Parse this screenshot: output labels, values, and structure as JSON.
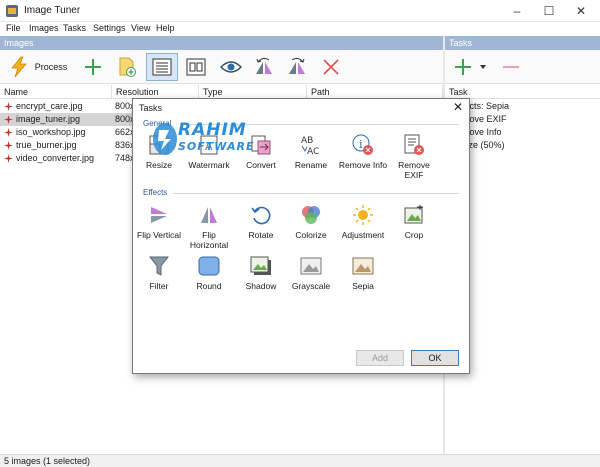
{
  "window": {
    "title": "Image Tuner",
    "controls": {
      "minimize": "–",
      "maximize": "☐",
      "close": "✕"
    }
  },
  "menu": [
    "File",
    "Images",
    "Tasks",
    "Settings",
    "View",
    "Help"
  ],
  "panels": {
    "images_header": "Images",
    "tasks_header": "Tasks"
  },
  "toolbar": {
    "process_label": "Process"
  },
  "columns": {
    "name": "Name",
    "resolution": "Resolution",
    "type": "Type",
    "path": "Path",
    "task": "Task"
  },
  "files": [
    {
      "name": "encrypt_care.jpg",
      "resolution": "800x",
      "selected": false
    },
    {
      "name": "image_tuner.jpg",
      "resolution": "800x",
      "selected": true
    },
    {
      "name": "iso_workshop.jpg",
      "resolution": "662x",
      "selected": false
    },
    {
      "name": "true_burner.jpg",
      "resolution": "836x",
      "selected": false
    },
    {
      "name": "video_converter.jpg",
      "resolution": "748x",
      "selected": false
    }
  ],
  "tasks_list": [
    "fects: Sepia",
    "move EXIF",
    "move Info",
    "size (50%)"
  ],
  "status": "5 images (1 selected)",
  "dialog": {
    "title": "Tasks",
    "close": "✕",
    "general_label": "General",
    "effects_label": "Effects",
    "general_items": [
      "Resize",
      "Watermark",
      "Convert",
      "Rename",
      "Remove Info",
      "Remove EXIF"
    ],
    "effects_row1": [
      "Flip Vertical",
      "Flip Horizontal",
      "Rotate",
      "Colorize",
      "Adjustment",
      "Crop"
    ],
    "effects_row2": [
      "Filter",
      "Round",
      "Shadow",
      "Grayscale",
      "Sepia"
    ],
    "add_button": "Add",
    "ok_button": "OK"
  },
  "watermark": {
    "line1": "RAHIM",
    "line2": "SOFTWARE"
  },
  "colors": {
    "accent": "#2d8cd6",
    "selection": "#d4d4d4",
    "header": "#9fb6d4",
    "remove_red": "#d9534f",
    "add_green": "#3aa24a"
  }
}
